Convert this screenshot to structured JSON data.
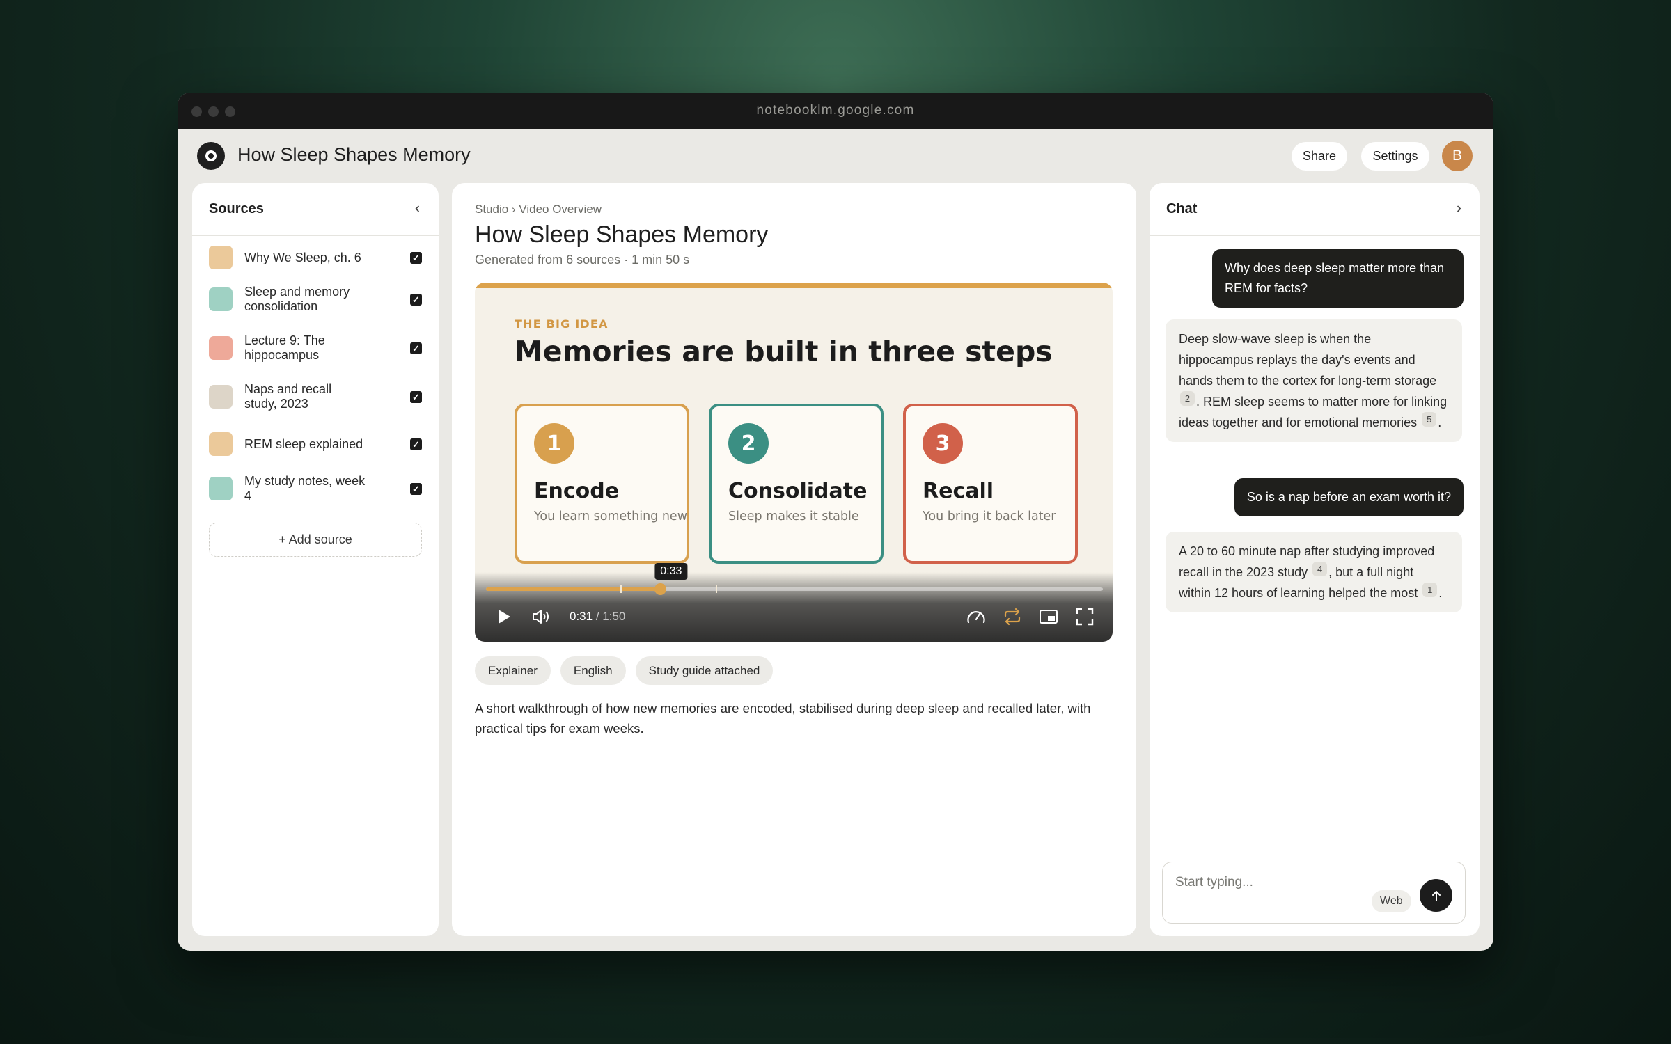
{
  "window": {
    "url": "notebooklm.google.com"
  },
  "header": {
    "notebook_title": "How Sleep Shapes Memory",
    "share_label": "Share",
    "settings_label": "Settings",
    "avatar_initial": "B"
  },
  "sources": {
    "title": "Sources",
    "collapse_icon": "chevron-left-icon",
    "items": [
      {
        "label": "Why We Sleep, ch. 6",
        "color": "#ebc99a",
        "checked": true
      },
      {
        "label": "Sleep and memory consolidation",
        "color": "#9fd1c3",
        "checked": true
      },
      {
        "label": "Lecture 9: The hippocampus",
        "color": "#eea999",
        "checked": true
      },
      {
        "label": "Naps and recall study, 2023",
        "color": "#ddd5c8",
        "checked": true
      },
      {
        "label": "REM sleep explained",
        "color": "#ebc99a",
        "checked": true
      },
      {
        "label": "My study notes, week 4",
        "color": "#9fd1c3",
        "checked": true
      }
    ],
    "add_label": "+ Add source"
  },
  "studio": {
    "breadcrumb": "Studio › Video Overview",
    "title": "How Sleep Shapes Memory",
    "subtitle": "Generated from 6 sources · 1 min 50 s",
    "video": {
      "kicker": "THE BIG IDEA",
      "slide_title": "Memories are built in three steps",
      "steps": [
        {
          "num": "1",
          "name": "Encode",
          "desc": "You learn something new",
          "color": "#d8a04e"
        },
        {
          "num": "2",
          "name": "Consolidate",
          "desc": "Sleep makes it stable",
          "color": "#3b8f83"
        },
        {
          "num": "3",
          "name": "Recall",
          "desc": "You bring it back later",
          "color": "#d1614a"
        }
      ],
      "current_time": "0:31",
      "time_separator": " / ",
      "duration": "1:50",
      "hover_time": "0:33",
      "progress_fraction": 0.282,
      "hover_fraction": 0.3,
      "chapter_fractions": [
        0.218,
        0.372
      ],
      "accent": "#dca24b"
    },
    "tags": [
      "Explainer",
      "English",
      "Study guide attached"
    ],
    "description": "A short walkthrough of how new memories are encoded, stabilised during deep sleep and recalled later, with practical tips for exam weeks."
  },
  "chat": {
    "title": "Chat",
    "expand_icon": "chevron-right-icon",
    "messages": [
      {
        "role": "user",
        "text": "Why does deep sleep matter more than REM for facts?"
      },
      {
        "role": "ai",
        "parts": [
          {
            "t": "Deep slow-wave sleep is when the hippocampus replays the day's events and hands them to the cortex for long-term storage "
          },
          {
            "c": "2"
          },
          {
            "t": ". REM sleep seems to matter more for linking ideas together and for emotional memories "
          },
          {
            "c": "5"
          },
          {
            "t": "."
          }
        ]
      },
      {
        "role": "user",
        "text": "So is a nap before an exam worth it?"
      },
      {
        "role": "ai",
        "parts": [
          {
            "t": "A 20 to 60 minute nap after studying improved recall in the 2023 study "
          },
          {
            "c": "4"
          },
          {
            "t": ", but a full night within 12 hours of learning helped the most "
          },
          {
            "c": "1"
          },
          {
            "t": "."
          }
        ]
      }
    ],
    "input_placeholder": "Start typing...",
    "web_label": "Web"
  }
}
